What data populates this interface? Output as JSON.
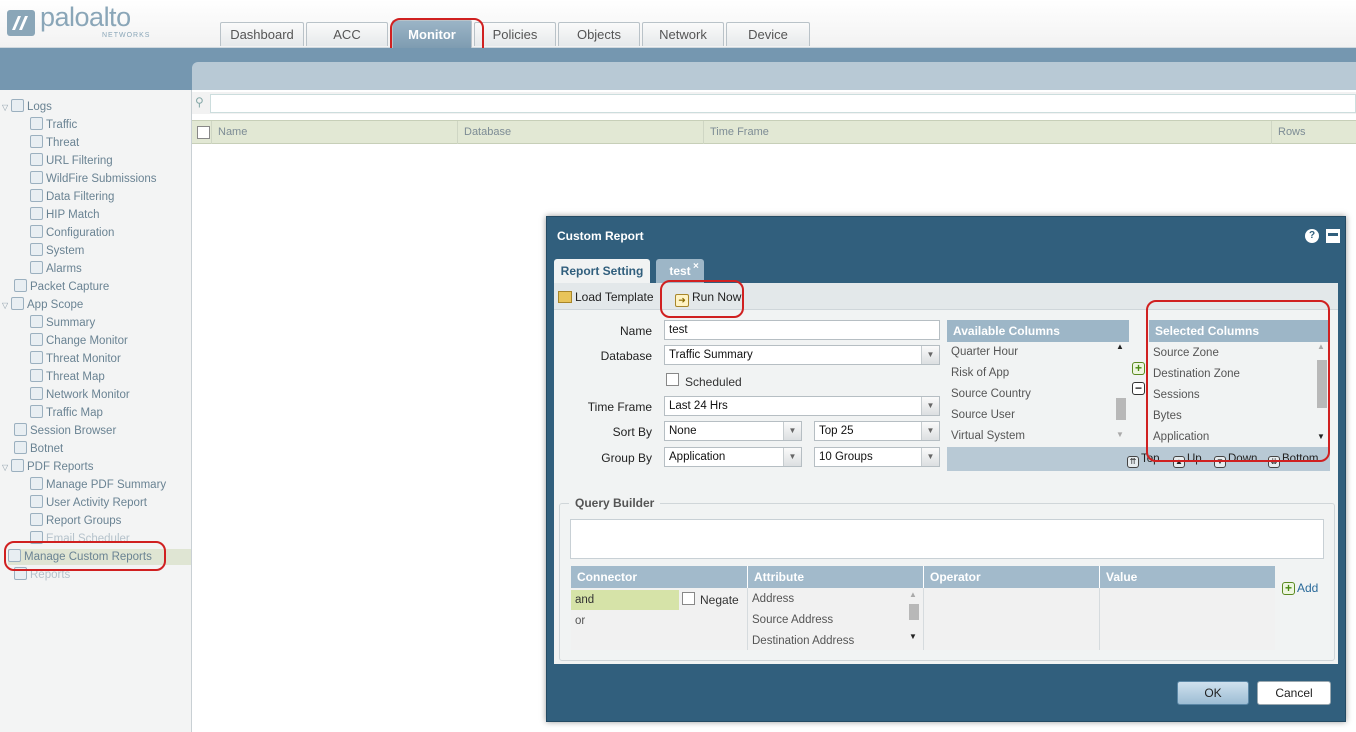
{
  "brand": {
    "name": "paloalto",
    "sub": "NETWORKS"
  },
  "tabs": [
    {
      "label": "Dashboard"
    },
    {
      "label": "ACC"
    },
    {
      "label": "Monitor"
    },
    {
      "label": "Policies"
    },
    {
      "label": "Objects"
    },
    {
      "label": "Network"
    },
    {
      "label": "Device"
    }
  ],
  "sidebar": {
    "items": [
      {
        "label": "Logs"
      },
      {
        "label": "Traffic"
      },
      {
        "label": "Threat"
      },
      {
        "label": "URL Filtering"
      },
      {
        "label": "WildFire Submissions"
      },
      {
        "label": "Data Filtering"
      },
      {
        "label": "HIP Match"
      },
      {
        "label": "Configuration"
      },
      {
        "label": "System"
      },
      {
        "label": "Alarms"
      },
      {
        "label": "Packet Capture"
      },
      {
        "label": "App Scope"
      },
      {
        "label": "Summary"
      },
      {
        "label": "Change Monitor"
      },
      {
        "label": "Threat Monitor"
      },
      {
        "label": "Threat Map"
      },
      {
        "label": "Network Monitor"
      },
      {
        "label": "Traffic Map"
      },
      {
        "label": "Session Browser"
      },
      {
        "label": "Botnet"
      },
      {
        "label": "PDF Reports"
      },
      {
        "label": "Manage PDF Summary"
      },
      {
        "label": "User Activity Report"
      },
      {
        "label": "Report Groups"
      },
      {
        "label": "Email Scheduler"
      },
      {
        "label": "Manage Custom Reports"
      },
      {
        "label": "Reports"
      }
    ]
  },
  "table": {
    "columns": [
      "Name",
      "Database",
      "Time Frame",
      "Rows"
    ]
  },
  "dialog": {
    "title": "Custom Report",
    "tabs": [
      "Report Setting",
      "test"
    ],
    "toolbar": {
      "load_template": "Load Template",
      "run_now": "Run Now"
    },
    "form": {
      "name_label": "Name",
      "name_value": "test",
      "database_label": "Database",
      "database_value": "Traffic Summary",
      "scheduled_label": "Scheduled",
      "timeframe_label": "Time Frame",
      "timeframe_value": "Last 24 Hrs",
      "sortby_label": "Sort By",
      "sortby_value": "None",
      "sortby_top": "Top 25",
      "groupby_label": "Group By",
      "groupby_value": "Application",
      "groupby_groups": "10 Groups"
    },
    "available_columns": {
      "title": "Available Columns",
      "items": [
        "Quarter Hour",
        "Risk of App",
        "Source Country",
        "Source User",
        "Virtual System"
      ]
    },
    "selected_columns": {
      "title": "Selected Columns",
      "items": [
        "Source Zone",
        "Destination Zone",
        "Sessions",
        "Bytes",
        "Application"
      ]
    },
    "move_buttons": {
      "top": "Top",
      "up": "Up",
      "down": "Down",
      "bottom": "Bottom"
    },
    "query_builder": {
      "title": "Query Builder",
      "headers": [
        "Connector",
        "Attribute",
        "Operator",
        "Value"
      ],
      "connectors": [
        "and",
        "or"
      ],
      "negate_label": "Negate",
      "attributes": [
        "Address",
        "Source Address",
        "Destination Address"
      ],
      "add_label": "Add"
    },
    "ok_label": "OK",
    "cancel_label": "Cancel"
  },
  "colors": {
    "annotation": "#d02020",
    "header_blue": "#315f7d",
    "accent": "#7597b0"
  }
}
